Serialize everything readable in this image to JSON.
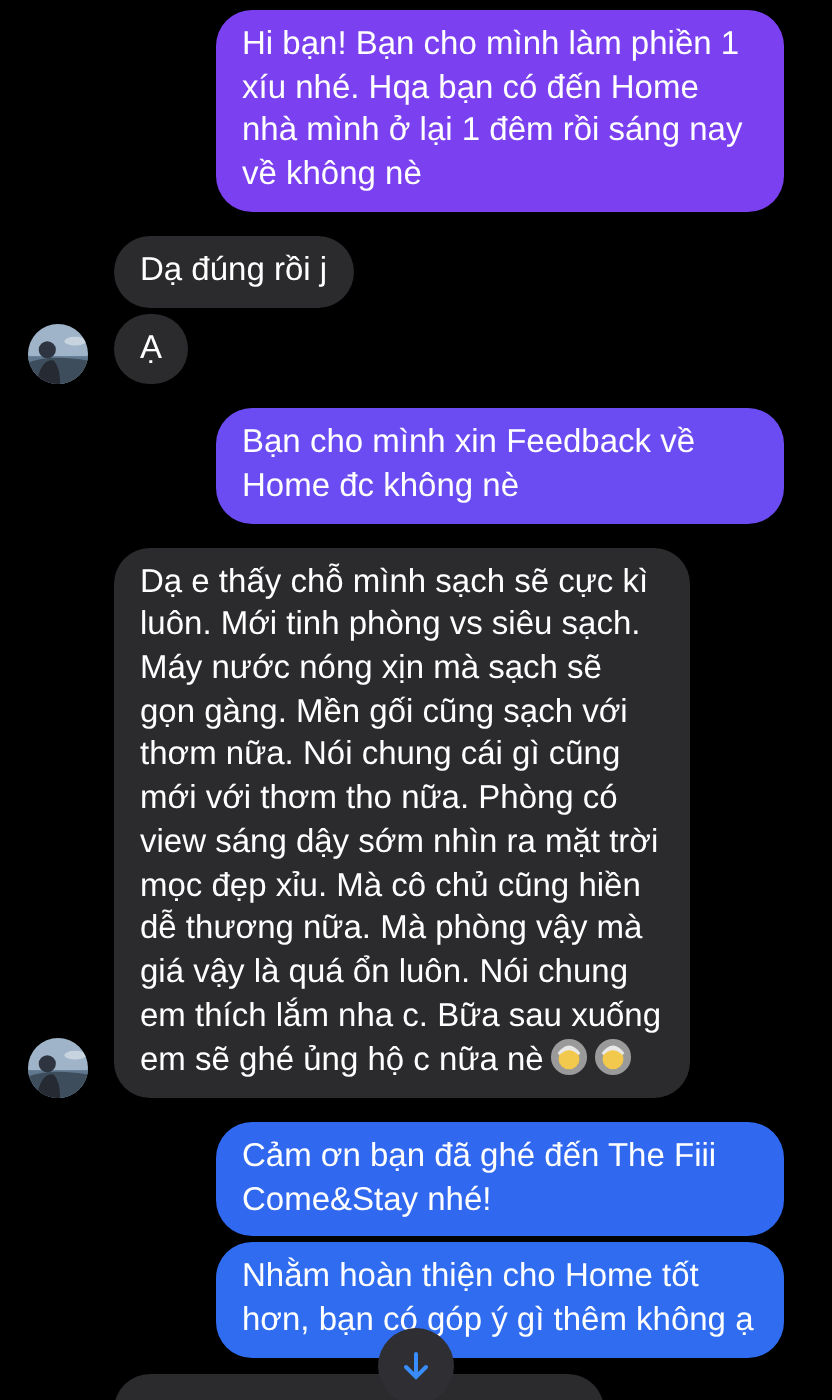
{
  "messages": [
    {
      "kind": "sent",
      "text": "Hi bạn! Bạn cho mình làm phiền 1 xíu nhé. Hqa bạn có đến Home nhà mình ở lại 1 đêm rồi sáng nay về không nè"
    },
    {
      "kind": "received",
      "text": "Dạ đúng rồi j",
      "avatar": false
    },
    {
      "kind": "received",
      "text": "Ạ",
      "avatar": true
    },
    {
      "kind": "sent",
      "text": "Bạn cho mình xin Feedback về Home đc không nè"
    },
    {
      "kind": "received",
      "text": "Dạ e thấy chỗ mình sạch sẽ cực kì luôn. Mới tinh phòng vs siêu sạch. Máy nước nóng xịn mà sạch sẽ gọn gàng. Mền gối cũng sạch với thơm nữa. Nói chung cái gì cũng mới với thơm tho nữa. Phòng có view sáng dậy sớm nhìn ra mặt trời mọc đẹp xỉu. Mà cô chủ cũng hiền dễ thương nữa. Mà phòng vậy mà giá vậy là quá ổn luôn. Nói chung em thích lắm nha c. Bữa sau xuống em sẽ ghé ủng hộ c nữa nè",
      "emoji": true,
      "avatar": true
    },
    {
      "kind": "sent",
      "text": "Cảm ơn bạn đã ghé đến The Fiii Come&Stay nhé!"
    },
    {
      "kind": "sent",
      "text": "Nhằm hoàn thiện cho Home tốt hơn, bạn có góp ý gì thêm không ạ"
    },
    {
      "kind": "cut_off"
    }
  ],
  "scroll_down_button": true
}
